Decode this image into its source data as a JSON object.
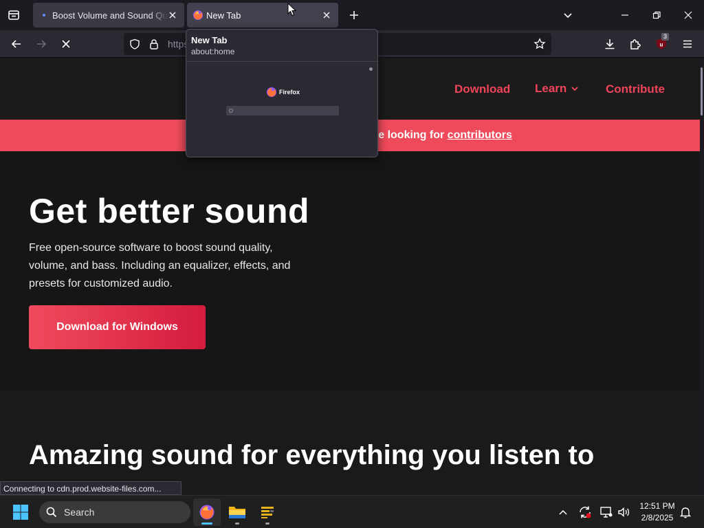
{
  "browser": {
    "tabs": [
      {
        "title": "Boost Volume and Sound Quality"
      },
      {
        "title": "New Tab"
      }
    ],
    "url_prefix": "https",
    "extension_badge": "3"
  },
  "page": {
    "nav": {
      "download": "Download",
      "learn": "Learn",
      "contribute": "Contribute"
    },
    "banner": {
      "text": "re looking for ",
      "link": "contributors"
    },
    "hero": {
      "title": "Get better sound",
      "description": "Free open-source software to boost sound quality, volume, and bass. Including an equalizer, effects, and presets for customized audio.",
      "cta": "Download for Windows"
    },
    "section2": {
      "title": "Amazing sound for everything you listen to"
    }
  },
  "status": "Connecting to cdn.prod.website-files.com...",
  "preview": {
    "title": "New Tab",
    "url": "about:home",
    "thumb_brand": "Firefox"
  },
  "taskbar": {
    "search": "Search",
    "time": "12:51 PM",
    "date": "2/8/2025"
  },
  "colors": {
    "accent": "#f0445a",
    "banner": "#ee4a5b"
  }
}
